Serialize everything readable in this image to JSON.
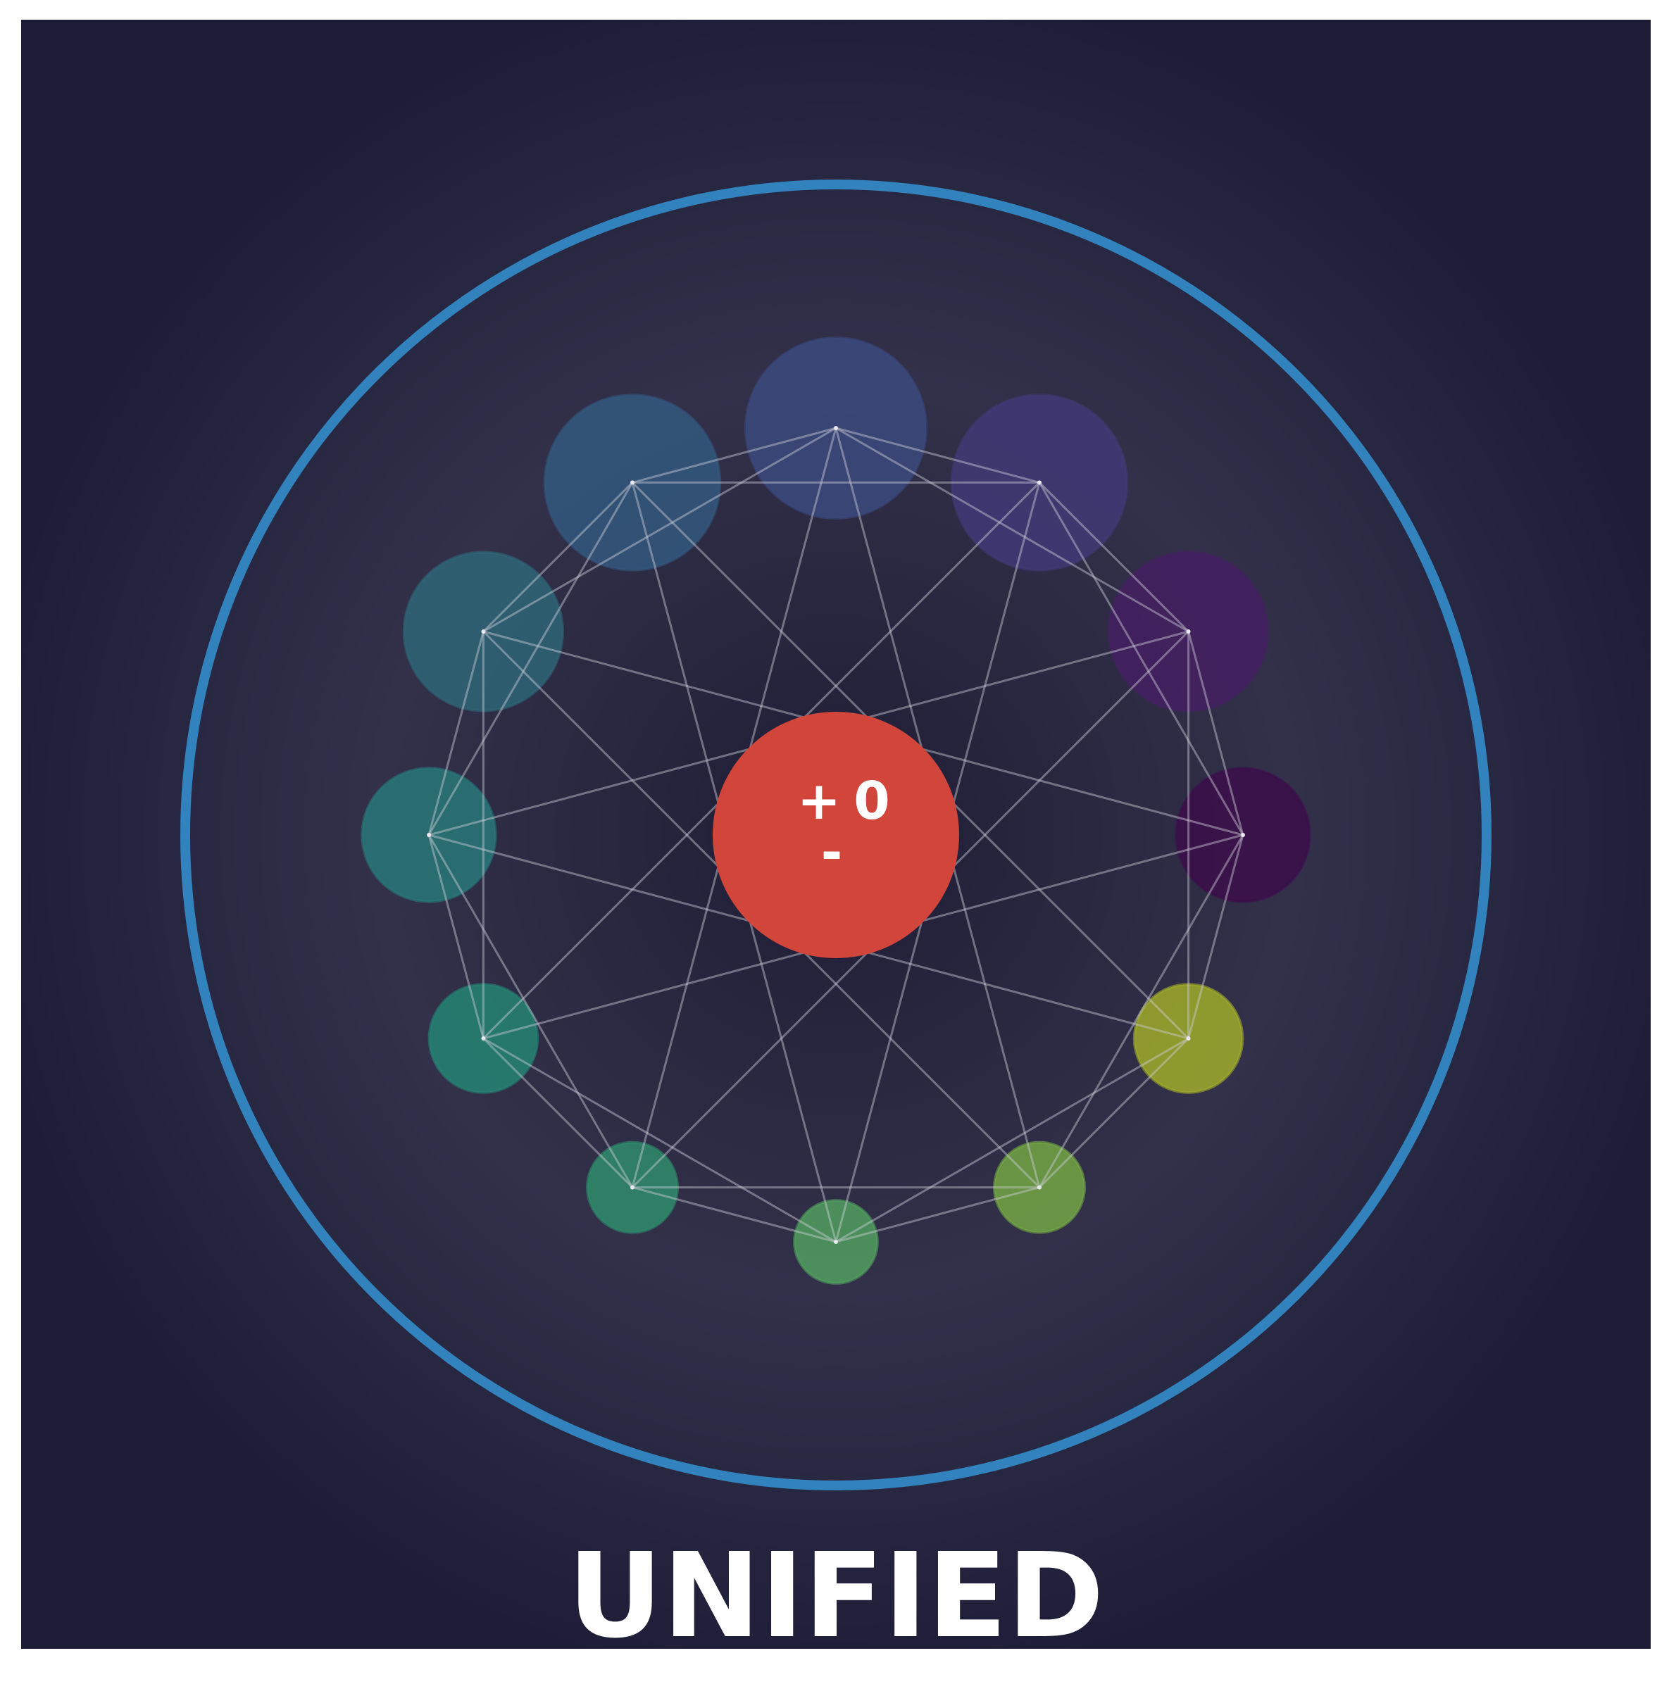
{
  "title": "UNIFIED",
  "center": {
    "plus": "+",
    "value": "0",
    "minus": "-",
    "color": "#d1453b"
  },
  "colors": {
    "background_center": "#1e1d35",
    "background_mid": "#33314a",
    "background_edge": "#1e1d38",
    "outer_ring": "#3182bd",
    "edge_line": "#cfcfd6"
  },
  "nodes": [
    {
      "name": "node-top",
      "color": "#3b4a7e",
      "size": 1.0
    },
    {
      "name": "node-upper-right",
      "color": "#413a77",
      "size": 0.97
    },
    {
      "name": "node-right-upper",
      "color": "#442062",
      "size": 0.88
    },
    {
      "name": "node-right",
      "color": "#3c0e4b",
      "size": 0.74
    },
    {
      "name": "node-right-lower",
      "color": "#9fab2a",
      "size": 0.6
    },
    {
      "name": "node-lower-right",
      "color": "#73a644",
      "size": 0.5
    },
    {
      "name": "node-bottom",
      "color": "#519f5f",
      "size": 0.46
    },
    {
      "name": "node-lower-left",
      "color": "#2f8c6b",
      "size": 0.5
    },
    {
      "name": "node-left-lower",
      "color": "#248473",
      "size": 0.6
    },
    {
      "name": "node-left",
      "color": "#287879",
      "size": 0.74
    },
    {
      "name": "node-left-upper",
      "color": "#2e6577",
      "size": 0.88
    },
    {
      "name": "node-upper-left",
      "color": "#33587e",
      "size": 0.97
    }
  ]
}
